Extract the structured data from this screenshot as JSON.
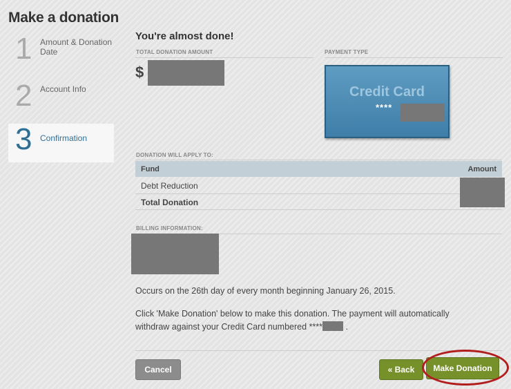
{
  "page": {
    "title": "Make a donation"
  },
  "steps": [
    {
      "number": "1",
      "label": "Amount & Donation Date",
      "active": false
    },
    {
      "number": "2",
      "label": "Account Info",
      "active": false
    },
    {
      "number": "3",
      "label": "Confirmation",
      "active": true
    }
  ],
  "main": {
    "heading": "You're almost done!",
    "total_label": "TOTAL DONATION AMOUNT",
    "currency_symbol": "$",
    "payment_label": "PAYMENT TYPE",
    "card": {
      "title": "Credit Card",
      "masked": "****"
    },
    "apply_label": "DONATION WILL APPLY TO:",
    "table": {
      "headers": [
        "Fund",
        "Amount"
      ],
      "rows": [
        {
          "fund": "Debt Reduction"
        }
      ],
      "total_label": "Total Donation"
    },
    "billing_label": "BILLING INFORMATION:",
    "occurs_text": "Occurs on the 26th day of every month beginning January 26, 2015.",
    "instruction_line1": "Click 'Make Donation' below to make this donation. The payment will automatically",
    "instruction_line2": "withdraw against your Credit Card numbered ****",
    "instruction_end": "."
  },
  "buttons": {
    "cancel": "Cancel",
    "back": "« Back",
    "donate": "Make Donation"
  },
  "colors": {
    "accent_green": "#76902a",
    "step_active": "#2f6f94",
    "card_blue": "#4a88b3",
    "highlight": "#b21e1e"
  }
}
